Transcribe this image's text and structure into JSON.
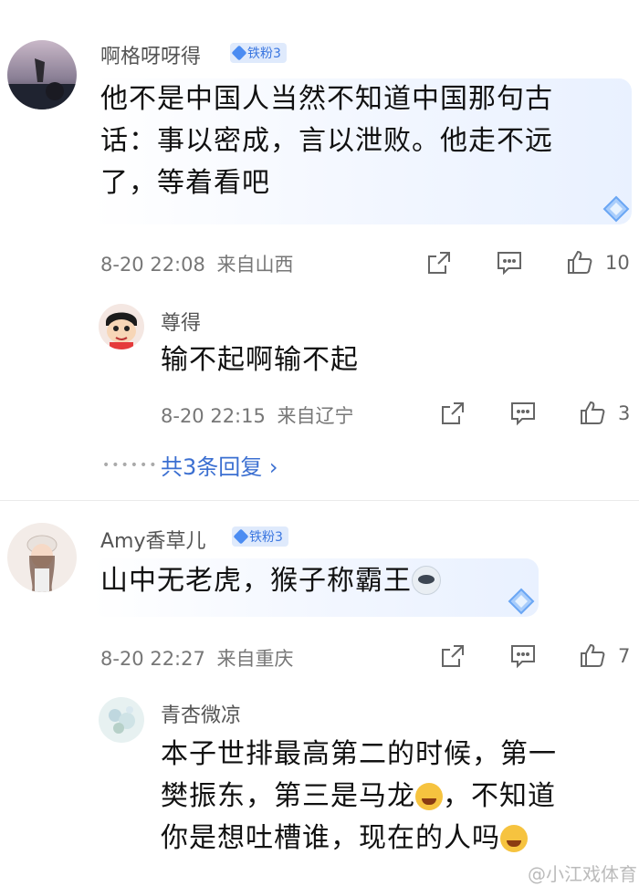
{
  "comments": [
    {
      "username": "啊格呀呀得",
      "badge": "铁粉3",
      "text_lines": [
        "他不是中国人当然不知道中国那句古",
        "话：事以密成，言以泄败。他走不远",
        "了，等着看吧"
      ],
      "time": "8-20 22:08",
      "location": "来自山西",
      "likes": "10",
      "reply": {
        "username": "尊得",
        "text": "输不起啊输不起",
        "time": "8-20 22:15",
        "location": "来自辽宁",
        "likes": "3"
      },
      "more_replies": "共3条回复 ›"
    },
    {
      "username": "Amy香草儿",
      "badge": "铁粉3",
      "text": "山中无老虎，猴子称霸王",
      "time": "8-20 22:27",
      "location": "来自重庆",
      "likes": "7",
      "reply": {
        "username": "青杏微凉",
        "text_lines": [
          "本子世排最高第二的时候，第一",
          "樊振东，第三是马龙",
          "，不知道",
          "你是想吐槽谁，现在的人吗"
        ]
      }
    }
  ],
  "watermark": "@小江戏体育",
  "icons": [
    "share-icon",
    "comment-icon",
    "like-icon",
    "badge-gem-icon",
    "emoji-laugh-cry",
    "emoji-husky"
  ]
}
